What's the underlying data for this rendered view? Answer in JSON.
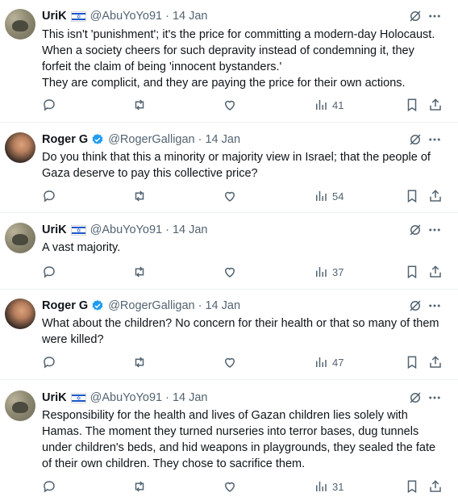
{
  "tweets": [
    {
      "name": "UriK",
      "has_flag": true,
      "handle": "@AbuYoYo91",
      "date": "14 Jan",
      "text": "This isn't 'punishment'; it's the price for committing a modern-day Holocaust. When a society cheers for such depravity instead of condemning it, they forfeit the claim of being 'innocent bystanders.'\nThey are complicit, and they are paying the price for their own actions.",
      "views": "41"
    },
    {
      "name": "Roger G",
      "verified": true,
      "handle": "@RogerGalligan",
      "date": "14 Jan",
      "text": "Do you think that this a minority or majority view in Israel; that the people of Gaza deserve to pay this collective price?",
      "views": "54"
    },
    {
      "name": "UriK",
      "has_flag": true,
      "handle": "@AbuYoYo91",
      "date": "14 Jan",
      "text": "A vast majority.",
      "views": "37"
    },
    {
      "name": "Roger G",
      "verified": true,
      "handle": "@RogerGalligan",
      "date": "14 Jan",
      "text": "What about the children? No concern for their health or that so many of them were killed?",
      "views": "47"
    },
    {
      "name": "UriK",
      "has_flag": true,
      "handle": "@AbuYoYo91",
      "date": "14 Jan",
      "text": "Responsibility for the health and lives of Gazan children lies solely with Hamas. The moment they turned nurseries into terror bases, dug tunnels under children's beds, and hid weapons in playgrounds, they sealed the fate of their own children. They chose to sacrifice them.",
      "views": "31"
    }
  ],
  "separator": "·",
  "flag_star": "✡",
  "colors": {
    "text": "#0f1419",
    "secondary": "#536471",
    "verified": "#1d9bf0",
    "flag_blue": "#1b56c8"
  },
  "icons": [
    "grok-icon",
    "more-icon",
    "reply-icon",
    "retweet-icon",
    "like-icon",
    "views-icon",
    "bookmark-icon",
    "share-icon",
    "verified-badge-icon",
    "israel-flag-icon"
  ]
}
